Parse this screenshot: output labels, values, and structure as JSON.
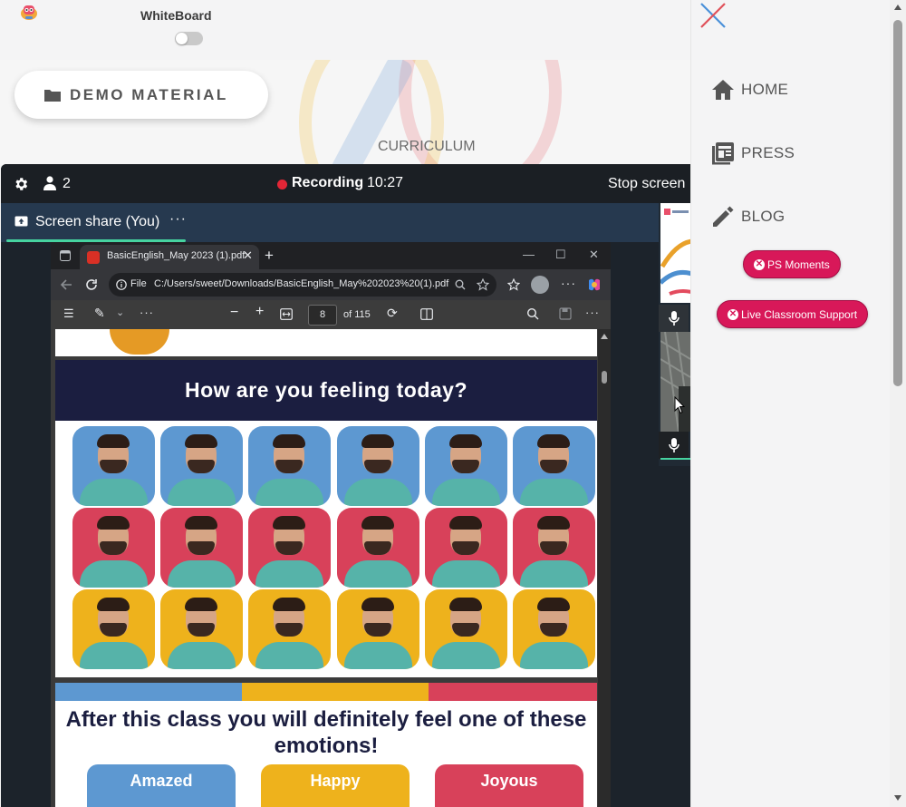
{
  "header": {
    "title": "WhiteBoard",
    "toggle_on": false
  },
  "board": {
    "demo_button": "DEMO MATERIAL",
    "curriculum_label": "CURRICULUM"
  },
  "meeting": {
    "participant_count": "2",
    "recording_label": "Recording",
    "recording_time": "10:27",
    "stop_share_label": "Stop screen",
    "share_tab_label": "Screen share (You)",
    "share_tab_more": "···"
  },
  "browser": {
    "tab_title": "BasicEnglish_May 2023 (1).pdf",
    "address_scheme": "File",
    "address_url": "C:/Users/sweet/Downloads/BasicEnglish_May%202023%20(1).pdf",
    "page_number": "8",
    "page_total": "of 115"
  },
  "pdf": {
    "heading": "How are you feeling today?",
    "grid_colors": [
      "blue",
      "red",
      "yellow"
    ],
    "faces_per_row": 6,
    "subheading": "After this class you will definitely feel one of these emotions!",
    "emotions": [
      "Amazed",
      "Happy",
      "Joyous"
    ],
    "colors": {
      "navy": "#1b1e40",
      "blue": "#5d98d1",
      "red": "#d8415a",
      "yellow": "#eeb21c"
    }
  },
  "drawer": {
    "nav": [
      {
        "label": "HOME",
        "icon": "home-icon"
      },
      {
        "label": "PRESS",
        "icon": "newspaper-icon"
      },
      {
        "label": "BLOG",
        "icon": "pencil-icon"
      }
    ],
    "pills": [
      "PS Moments",
      "Live Classroom Support"
    ],
    "accent": "#d81859"
  }
}
